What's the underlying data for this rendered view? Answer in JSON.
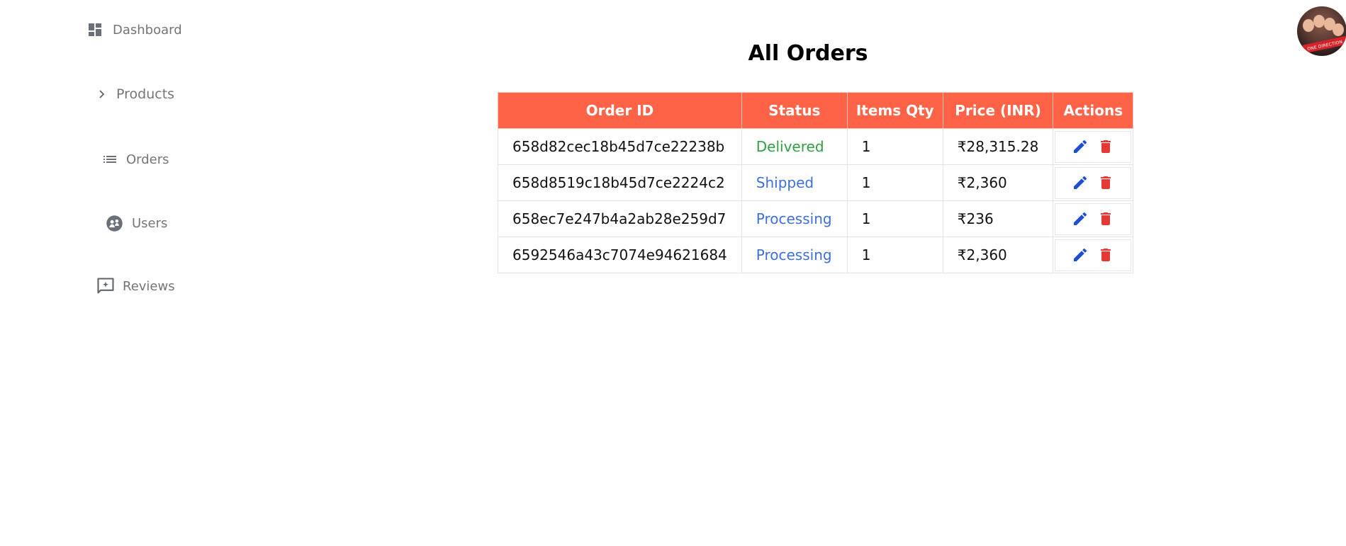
{
  "sidebar": {
    "items": [
      {
        "label": "Dashboard",
        "icon": "dashboard-icon"
      },
      {
        "label": "Products",
        "icon": "chevron-right-icon"
      },
      {
        "label": "Orders",
        "icon": "list-icon"
      },
      {
        "label": "Users",
        "icon": "users-icon"
      },
      {
        "label": "Reviews",
        "icon": "add-comment-icon"
      }
    ]
  },
  "header": {
    "avatar_badge": "ONE DIRECTION"
  },
  "main": {
    "title": "All Orders",
    "table": {
      "headers": [
        "Order ID",
        "Status",
        "Items Qty",
        "Price (INR)",
        "Actions"
      ],
      "rows": [
        {
          "id": "658d82cec18b45d7ce22238b",
          "status": "Delivered",
          "qty": "1",
          "price": "₹28,315.28"
        },
        {
          "id": "658d8519c18b45d7ce2224c2",
          "status": "Shipped",
          "qty": "1",
          "price": "₹2,360"
        },
        {
          "id": "658ec7e247b4a2ab28e259d7",
          "status": "Processing",
          "qty": "1",
          "price": "₹236"
        },
        {
          "id": "6592546a43c7074e94621684",
          "status": "Processing",
          "qty": "1",
          "price": "₹2,360"
        }
      ]
    }
  },
  "colors": {
    "header_bg": "#ff6347",
    "delivered": "#2ea043",
    "in_progress": "#3d6fd9",
    "edit_icon": "#1f4fd1",
    "delete_icon": "#e53935"
  }
}
